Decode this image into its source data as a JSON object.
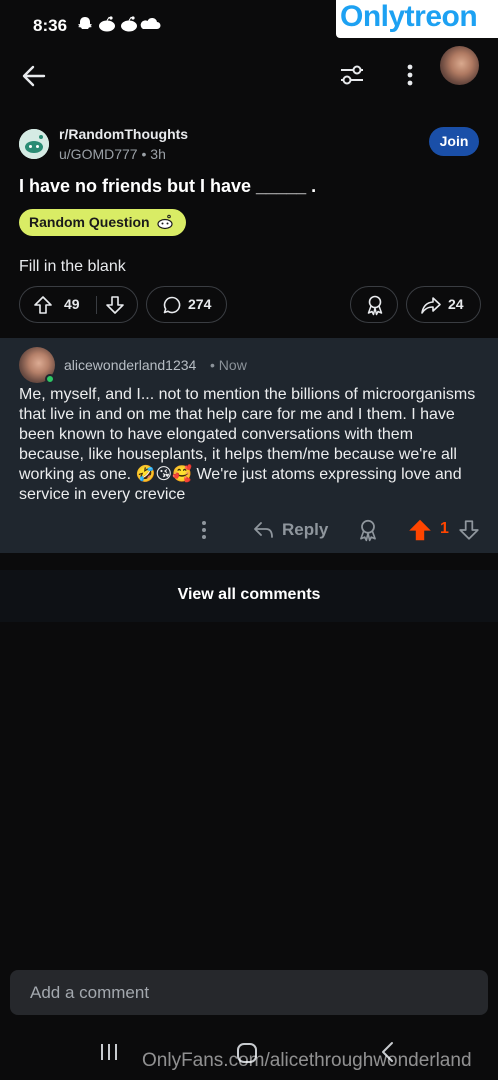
{
  "status_bar": {
    "time": "8:36",
    "icons": [
      "snapchat-icon",
      "reddit-icon",
      "reddit-icon",
      "cloud-icon"
    ]
  },
  "watermark": {
    "logo_text": "Onlytreon",
    "bottom_text": "OnlyFans.com/alicethroughwonderland"
  },
  "header": {
    "back_icon": "arrow-left-icon",
    "filter_icon": "sliders-icon",
    "more_icon": "vertical-dots-icon"
  },
  "post": {
    "subreddit": "r/RandomThoughts",
    "author": "u/GOMD777",
    "age": "3h",
    "join_label": "Join",
    "title": "I have no friends but I have _____ .",
    "flair": "Random Question",
    "body": "Fill in the blank",
    "score": "49",
    "comments": "274",
    "shares": "24"
  },
  "comment": {
    "author": "alicewonderland1234",
    "time": "Now",
    "text": "Me, myself, and I... not to mention the billions of microorganisms that live in and on me that help care for me and I them. I have been known to have elongated conversations with them because, like houseplants, it helps them/me because we're all working as one. 🤣😘🥰 We're just atoms expressing love and service in every crevice",
    "reply_label": "Reply",
    "score": "1"
  },
  "view_all_label": "View all comments",
  "add_comment_placeholder": "Add a comment",
  "colors": {
    "background": "#0b0b0c",
    "comment_card": "#1f262e",
    "join_button": "#1a4fa8",
    "flair": "#d9ec65",
    "upvote_active": "#ff4500",
    "online": "#2ec765"
  }
}
